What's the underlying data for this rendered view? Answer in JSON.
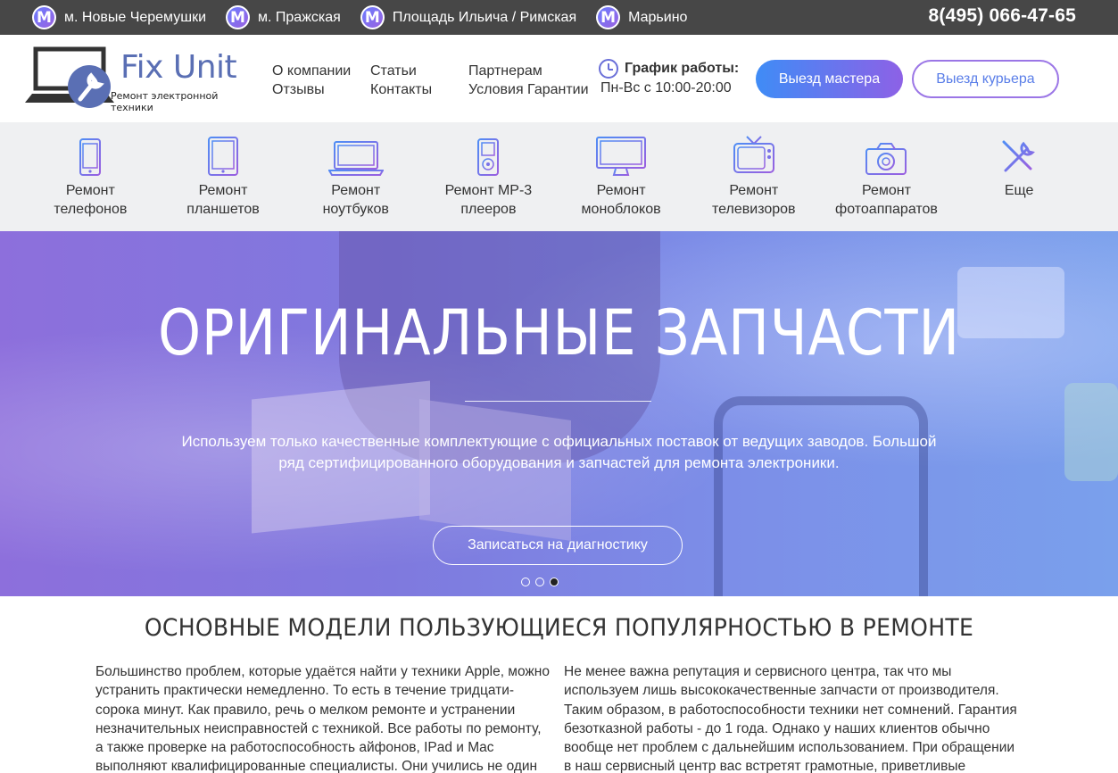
{
  "topbar": {
    "metro_symbol": "M",
    "stations": [
      "м. Новые Черемушки",
      "м. Пражская",
      "Площадь Ильича / Римская",
      "Марьино"
    ],
    "phone": "8(495) 066-47-65"
  },
  "logo": {
    "name": "Fix Unit",
    "tagline": "Ремонт электронной техники"
  },
  "nav": {
    "col1": [
      "О компании",
      "Отзывы"
    ],
    "col2": [
      "Статьи",
      "Контакты"
    ],
    "col3": [
      "Партнерам",
      "Условия Гарантии"
    ]
  },
  "schedule": {
    "title": "График работы:",
    "hours": "Пн-Вс с 10:00-20:00"
  },
  "buttons": {
    "master": "Выезд мастера",
    "courier": "Выезд курьера"
  },
  "categories": [
    {
      "label1": "Ремонт",
      "label2": "телефонов",
      "icon": "phone-icon"
    },
    {
      "label1": "Ремонт",
      "label2": "планшетов",
      "icon": "tablet-icon"
    },
    {
      "label1": "Ремонт",
      "label2": "ноутбуков",
      "icon": "laptop-icon"
    },
    {
      "label1": "Ремонт MP-3",
      "label2": "плееров",
      "icon": "mp3-player-icon"
    },
    {
      "label1": "Ремонт",
      "label2": "моноблоков",
      "icon": "monitor-icon"
    },
    {
      "label1": "Ремонт",
      "label2": "телевизоров",
      "icon": "tv-icon"
    },
    {
      "label1": "Ремонт",
      "label2": "фотоаппаратов",
      "icon": "camera-icon"
    },
    {
      "label1": "Еще",
      "label2": "",
      "icon": "tools-icon"
    }
  ],
  "hero": {
    "title": "ОРИГИНАЛЬНЫЕ ЗАПЧАСТИ",
    "text": "Используем только качественные комплектующие с официальных поставок от ведущих заводов. Большой ряд сертифицированного оборудования и запчастей для ремонта электроники.",
    "cta": "Записаться на диагностику",
    "slides": 3,
    "active_slide": 3
  },
  "content": {
    "heading": "ОСНОВНЫЕ МОДЕЛИ ПОЛЬЗУЮЩИЕСЯ ПОПУЛЯРНОСТЬЮ В РЕМОНТЕ",
    "left": "Большинство проблем, которые удаётся найти у техники Apple, можно устранить практически немедленно. То есть в течение тридцати-сорока минут. Как правило, речь о мелком ремонте и устранении незначительных неисправностей с техникой. Все работы по ремонту, а также проверке на работоспособность айфонов, IPad и Mac выполняют квалифицированные специалисты. Они учились не один год и долго",
    "right": "Не менее важна репутация и сервисного центра, так что мы используем лишь высококачественные запчасти от производителя. Таким образом, в работоспособности техники нет сомнений. Гарантия безотказной работы - до 1 года. Однако у наших клиентов обычно вообще нет проблем с дальнейшим использованием. При обращении в наш сервисный центр вас встретят грамотные, приветливые"
  },
  "colors": {
    "accent_blue": "#3f8cf6",
    "accent_purple": "#8d61e6",
    "topbar_bg": "#474747",
    "category_bg": "#eff0f2"
  }
}
